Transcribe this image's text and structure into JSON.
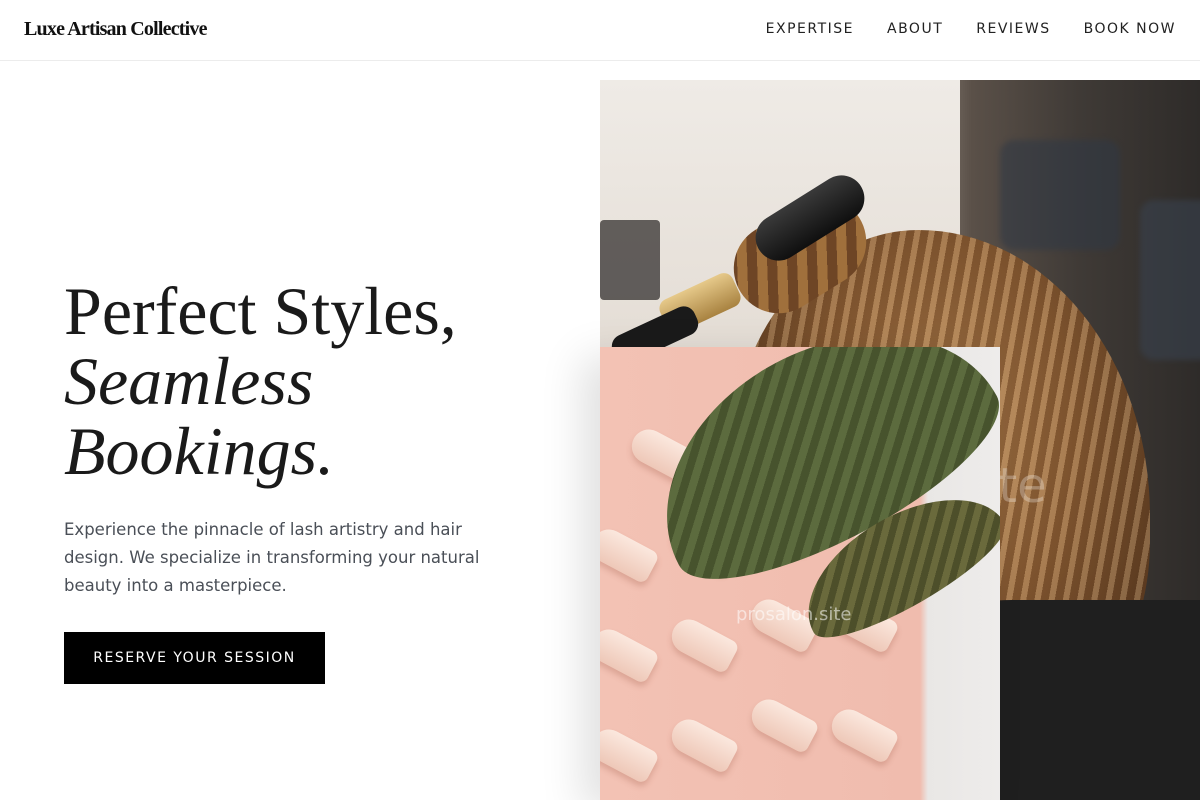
{
  "header": {
    "brand": "Luxe Artisan Collective",
    "nav": [
      "EXPERTISE",
      "ABOUT",
      "REVIEWS",
      "BOOK NOW"
    ]
  },
  "hero": {
    "headline_line1": "Perfect Styles,",
    "headline_line2": "Seamless",
    "headline_line3": "Bookings.",
    "description": "Experience the pinnacle of lash artistry and hair design. We specialize in transforming your natural beauty into a masterpiece.",
    "cta_label": "RESERVE YOUR SESSION"
  },
  "images": {
    "main_photo": "stylist-curling-hair-photo",
    "overlay_photo": "hair-dryers-wall-with-palm-leaf-photo",
    "watermark_main": "site",
    "watermark_overlay": "prosalon.site"
  },
  "colors": {
    "text": "#1a1a1a",
    "cta_background": "#000000",
    "cta_text": "#ffffff",
    "body_text": "#4a4f57"
  }
}
